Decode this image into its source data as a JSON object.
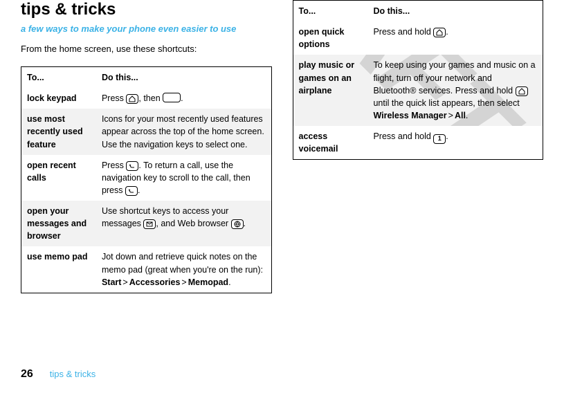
{
  "watermark": "DRAFT",
  "title": "tips & tricks",
  "subtitle": "a few ways to make your phone even easier to use",
  "intro": "From the home screen, use these shortcuts:",
  "headers": {
    "to": "To...",
    "do": "Do this..."
  },
  "left_rows": [
    {
      "action": "lock keypad",
      "segments": [
        {
          "t": "text",
          "v": "Press "
        },
        {
          "t": "key",
          "icon": "home"
        },
        {
          "t": "text",
          "v": ", then "
        },
        {
          "t": "key",
          "icon": "space"
        },
        {
          "t": "text",
          "v": "."
        }
      ],
      "alt": false
    },
    {
      "action": "use most recently used feature",
      "segments": [
        {
          "t": "text",
          "v": "Icons for your most recently used features appear across the top of the home screen. Use the navigation keys to select one."
        }
      ],
      "alt": true
    },
    {
      "action": "open recent calls",
      "segments": [
        {
          "t": "text",
          "v": "Press "
        },
        {
          "t": "key",
          "icon": "send"
        },
        {
          "t": "text",
          "v": ". To return a call, use the navigation key to scroll to the call, then press "
        },
        {
          "t": "key",
          "icon": "send"
        },
        {
          "t": "text",
          "v": "."
        }
      ],
      "alt": false
    },
    {
      "action": "open your messages and browser",
      "segments": [
        {
          "t": "text",
          "v": "Use shortcut keys to access your messages "
        },
        {
          "t": "key",
          "icon": "mail"
        },
        {
          "t": "text",
          "v": ", and Web browser "
        },
        {
          "t": "key",
          "icon": "globe"
        },
        {
          "t": "text",
          "v": "."
        }
      ],
      "alt": true
    },
    {
      "action": "use memo pad",
      "segments": [
        {
          "t": "text",
          "v": "Jot down and retrieve quick notes on the memo pad (great when you're on the run): "
        },
        {
          "t": "menu",
          "v": "Start"
        },
        {
          "t": "sep",
          "v": ">"
        },
        {
          "t": "menu",
          "v": "Accessories"
        },
        {
          "t": "sep",
          "v": ">"
        },
        {
          "t": "menu",
          "v": "Memopad"
        },
        {
          "t": "text",
          "v": "."
        }
      ],
      "alt": false
    }
  ],
  "right_rows": [
    {
      "action": "open quick options",
      "segments": [
        {
          "t": "text",
          "v": "Press and hold "
        },
        {
          "t": "key",
          "icon": "home"
        },
        {
          "t": "text",
          "v": "."
        }
      ],
      "alt": false
    },
    {
      "action": "play music or games on an airplane",
      "segments": [
        {
          "t": "text",
          "v": "To keep using your games and music on a flight, turn off your network and Bluetooth® services. Press and hold "
        },
        {
          "t": "key",
          "icon": "home"
        },
        {
          "t": "text",
          "v": " until the quick list appears, then select "
        },
        {
          "t": "menu",
          "v": "Wireless Manager"
        },
        {
          "t": "sep",
          "v": ">"
        },
        {
          "t": "menu",
          "v": "All"
        },
        {
          "t": "text",
          "v": "."
        }
      ],
      "alt": true
    },
    {
      "action": "access voicemail",
      "segments": [
        {
          "t": "text",
          "v": "Press and hold "
        },
        {
          "t": "key",
          "icon": "one"
        },
        {
          "t": "text",
          "v": "."
        }
      ],
      "alt": false
    }
  ],
  "footer": {
    "page": "26",
    "section": "tips & tricks"
  }
}
